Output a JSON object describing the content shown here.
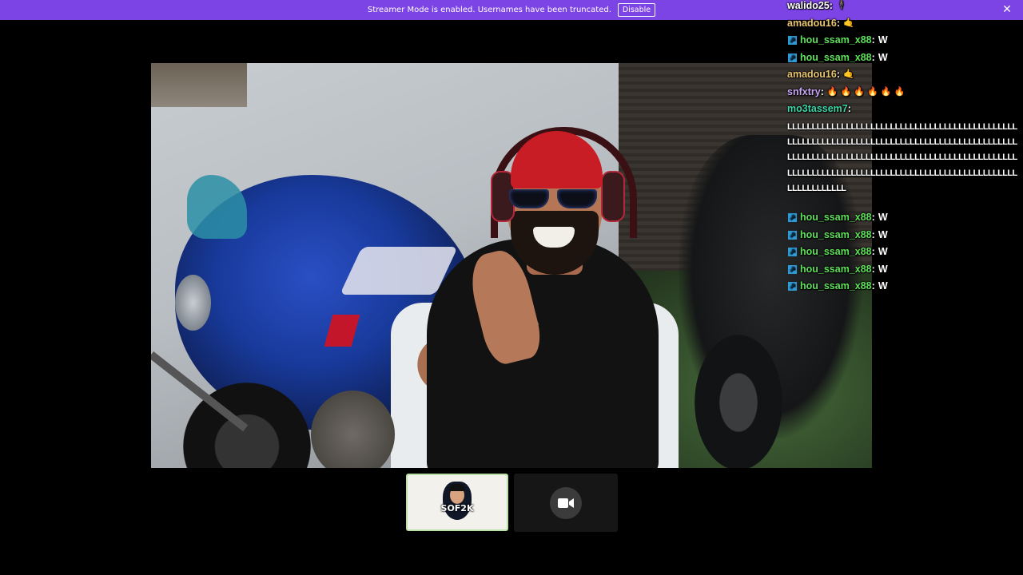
{
  "banner": {
    "message": "Streamer Mode is enabled. Usernames have been truncated.",
    "disable_label": "Disable",
    "close_icon": "close-icon",
    "background": "#7c44e4"
  },
  "chat": {
    "messages": [
      {
        "user": "walido25",
        "color": "#ffffff",
        "badge": false,
        "text": "",
        "emote": "🕴"
      },
      {
        "user": "amadou16",
        "color": "#e8c56f",
        "badge": false,
        "text": "",
        "emote": "🤙"
      },
      {
        "user": "hou_ssam_x88",
        "color": "#5fe05a",
        "badge": true,
        "text": "W",
        "emote": ""
      },
      {
        "user": "hou_ssam_x88",
        "color": "#5fe05a",
        "badge": true,
        "text": "W",
        "emote": ""
      },
      {
        "user": "amadou16",
        "color": "#e8c56f",
        "badge": false,
        "text": "",
        "emote": "🤙"
      },
      {
        "user": "snfxtry",
        "color": "#c9a6f5",
        "badge": false,
        "text": "",
        "emote": "🔥 🔥 🔥 🔥 🔥 🔥"
      },
      {
        "user": "mo3tassem7",
        "color": "#3fd6a8",
        "badge": false,
        "text": "",
        "emote": ""
      }
    ],
    "spam_text": "LLLLLLLLLLLLLLLLLLLLLLLLLLLLLLLLLLLLLLLLLLLLLLLLLLLLLLLLLLLLLLLLLLLLLLLLLLLLLLLLLLLLLLLLLLLLLLLLLLLLLLLLLLLLLLLLLLLLLLLLLLLLLLLLLLLLLLLLLLLLLLLLLLLLLLLLLLLLLLLLLLLLLLLLLLLLLLLLLLLLLLLLLLLLLLLLLLLLLLLL",
    "after_spam": [
      {
        "user": "hou_ssam_x88",
        "color": "#5fe05a",
        "badge": true,
        "text": "W"
      },
      {
        "user": "hou_ssam_x88",
        "color": "#5fe05a",
        "badge": true,
        "text": "W"
      },
      {
        "user": "hou_ssam_x88",
        "color": "#5fe05a",
        "badge": true,
        "text": "W"
      },
      {
        "user": "hou_ssam_x88",
        "color": "#5fe05a",
        "badge": true,
        "text": "W"
      },
      {
        "user": "hou_ssam_x88",
        "color": "#5fe05a",
        "badge": true,
        "text": "W"
      }
    ],
    "separator": " :"
  },
  "thumbnails": {
    "active": {
      "logo_text": "SOF2K",
      "icon": "channel-logo-icon"
    },
    "camera": {
      "icon": "camera-icon"
    }
  }
}
